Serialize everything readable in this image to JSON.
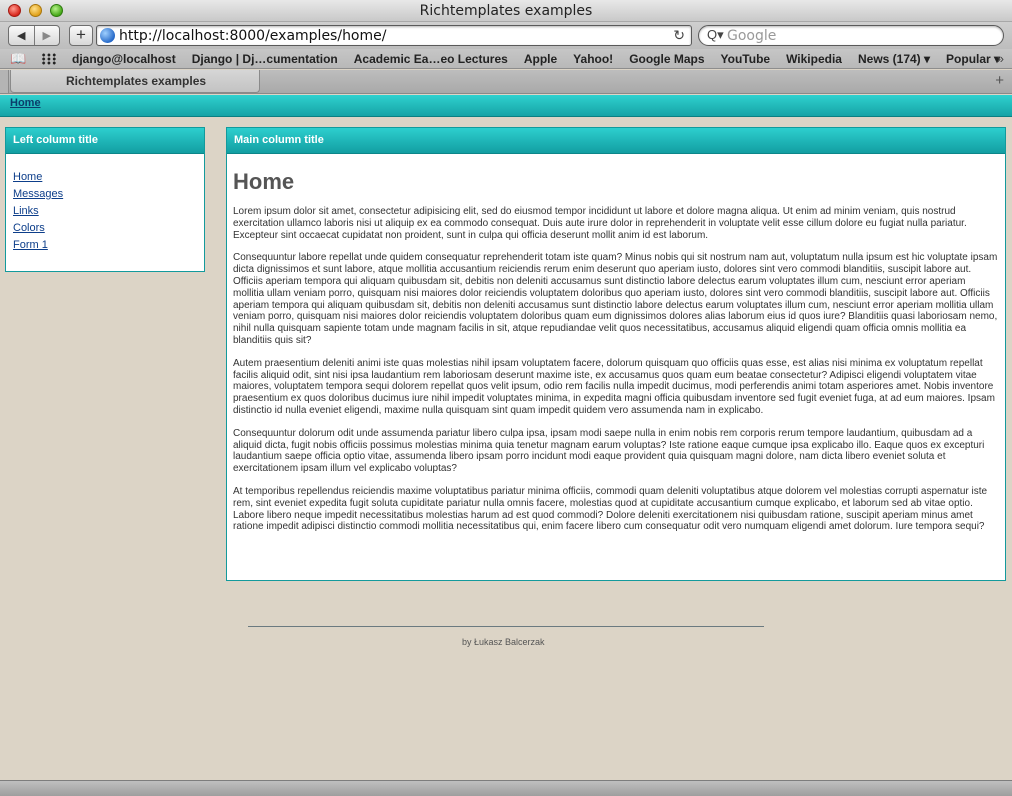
{
  "window": {
    "title": "Richtemplates examples"
  },
  "toolbar": {
    "back_label": "◀",
    "forward_label": "▶",
    "add_label": "+",
    "url": "http://localhost:8000/examples/home/",
    "reload_label": "↻",
    "search_placeholder": "Google",
    "search_icon": "Q▾"
  },
  "bookmarks": {
    "book_icon": "📖",
    "overflow_label": "»",
    "items": [
      "django@localhost",
      "Django | Dj…cumentation",
      "Academic Ea…eo Lectures",
      "Apple",
      "Yahoo!",
      "Google Maps",
      "YouTube",
      "Wikipedia",
      "News (174) ▾",
      "Popular ▾"
    ]
  },
  "tabs": {
    "active_label": "Richtemplates examples",
    "new_tab_label": "+"
  },
  "nav": {
    "home_label": "Home"
  },
  "left_column": {
    "title": "Left column title",
    "links": [
      "Home",
      "Messages",
      "Links",
      "Colors",
      "Form 1"
    ]
  },
  "main_column": {
    "title": "Main column title",
    "heading": "Home",
    "paragraphs": [
      "Lorem ipsum dolor sit amet, consectetur adipisicing elit, sed do eiusmod tempor incididunt ut labore et dolore magna aliqua. Ut enim ad minim veniam, quis nostrud exercitation ullamco laboris nisi ut aliquip ex ea commodo consequat. Duis aute irure dolor in reprehenderit in voluptate velit esse cillum dolore eu fugiat nulla pariatur. Excepteur sint occaecat cupidatat non proident, sunt in culpa qui officia deserunt mollit anim id est laborum.",
      "Consequuntur labore repellat unde quidem consequatur reprehenderit totam iste quam? Minus nobis qui sit nostrum nam aut, voluptatum nulla ipsum est hic voluptate ipsam dicta dignissimos et sunt labore, atque mollitia accusantium reiciendis rerum enim deserunt quo aperiam iusto, dolores sint vero commodi blanditiis, suscipit labore aut. Officiis aperiam tempora qui aliquam quibusdam sit, debitis non deleniti accusamus sunt distinctio labore delectus earum voluptates illum cum, nesciunt error aperiam mollitia ullam veniam porro, quisquam nisi maiores dolor reiciendis voluptatem doloribus quo aperiam iusto, dolores sint vero commodi blanditiis, suscipit labore aut. Officiis aperiam tempora qui aliquam quibusdam sit, debitis non deleniti accusamus sunt distinctio labore delectus earum voluptates illum cum, nesciunt error aperiam mollitia ullam veniam porro, quisquam nisi maiores dolor reiciendis voluptatem doloribus quam eum dignissimos dolores alias laborum eius id quos iure? Blanditiis quasi laboriosam nemo, nihil nulla quisquam sapiente totam unde magnam facilis in sit, atque repudiandae velit quos necessitatibus, accusamus aliquid eligendi quam officia omnis mollitia ea blanditiis quis sit?",
      "Autem praesentium deleniti animi iste quas molestias nihil ipsam voluptatem facere, dolorum quisquam quo officiis quas esse, est alias nisi minima ex voluptatum repellat facilis aliquid odit, sint nisi ipsa laudantium rem laboriosam deserunt maxime iste, ex accusamus quos quam eum beatae consectetur? Adipisci eligendi voluptatem vitae maiores, voluptatem tempora sequi dolorem repellat quos velit ipsum, odio rem facilis nulla impedit ducimus, modi perferendis animi totam asperiores amet. Nobis inventore praesentium ex quos doloribus ducimus iure nihil impedit voluptates minima, in expedita magni officia quibusdam inventore sed fugit eveniet fuga, at ad eum maiores. Ipsam distinctio id nulla eveniet eligendi, maxime nulla quisquam sint quam impedit quidem vero assumenda nam in explicabo.",
      "Consequuntur dolorum odit unde assumenda pariatur libero culpa ipsa, ipsam modi saepe nulla in enim nobis rem corporis rerum tempore laudantium, quibusdam ad a aliquid dicta, fugit nobis officiis possimus molestias minima quia tenetur magnam earum voluptas? Iste ratione eaque cumque ipsa explicabo illo. Eaque quos ex excepturi laudantium saepe officia optio vitae, assumenda libero ipsam porro incidunt modi eaque provident quia quisquam magni dolore, nam dicta libero eveniet soluta et exercitationem ipsam illum vel explicabo voluptas?",
      "At temporibus repellendus reiciendis maxime voluptatibus pariatur minima officiis, commodi quam deleniti voluptatibus atque dolorem vel molestias corrupti aspernatur iste rem, sint eveniet expedita fugit soluta cupiditate pariatur nulla omnis facere, molestias quod at cupiditate accusantium cumque explicabo, et laborum sed ab vitae optio. Labore libero neque impedit necessitatibus molestias harum ad est quod commodi? Dolore deleniti exercitationem nisi quibusdam ratione, suscipit aperiam minus amet ratione impedit adipisci distinctio commodi mollitia necessitatibus qui, enim facere libero cum consequatur odit vero numquam eligendi amet dolorum. Iure tempora sequi?"
    ]
  },
  "footer": {
    "credit": "by Łukasz Balcerzak"
  }
}
